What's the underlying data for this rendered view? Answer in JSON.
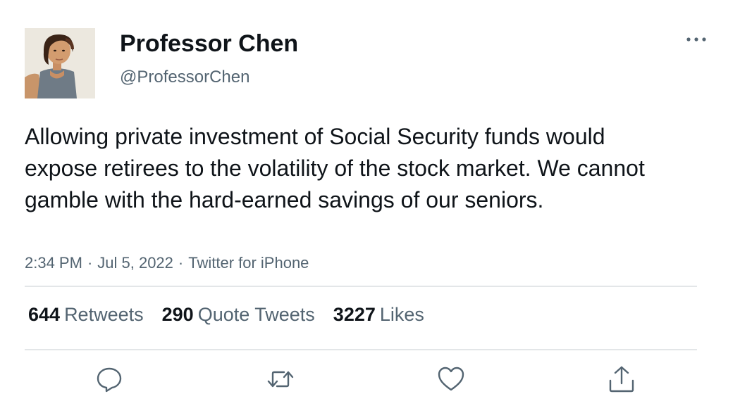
{
  "user": {
    "display_name": "Professor Chen",
    "handle": "@ProfessorChen"
  },
  "tweet": {
    "text": "Allowing private investment of Social Security funds would expose retirees to the volatility of the stock market. We cannot gamble with the hard-earned savings of our seniors.",
    "time": "2:34 PM",
    "date": "Jul 5, 2022",
    "source": "Twitter for iPhone",
    "separator": "·"
  },
  "stats": {
    "retweets": {
      "count": "644",
      "label": "Retweets"
    },
    "quote_tweets": {
      "count": "290",
      "label": "Quote Tweets"
    },
    "likes": {
      "count": "3227",
      "label": "Likes"
    }
  },
  "actions": [
    "reply-icon",
    "retweet-icon",
    "like-icon",
    "share-icon"
  ],
  "colors": {
    "text_primary": "#0f1419",
    "text_secondary": "#536471",
    "divider": "#e3e6e8",
    "icon": "#536471"
  }
}
